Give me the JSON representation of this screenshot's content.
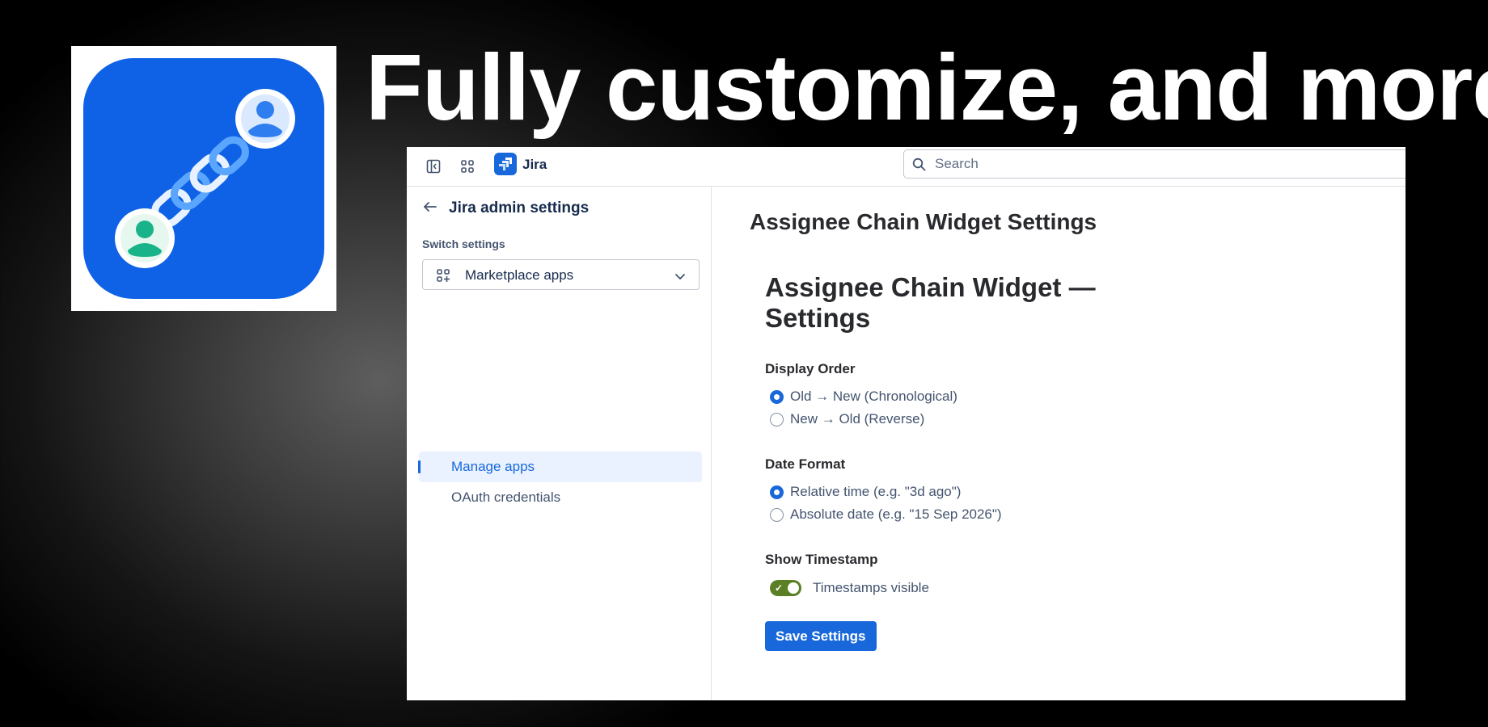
{
  "headline": "Fully customize, and more",
  "app_logo": {
    "icon": "assignee-chain-icon",
    "colors": {
      "tile": "#0f62e6",
      "avatar_top": "#2f7ef0",
      "avatar_bottom": "#19b389",
      "chain": "#5aa6ff"
    }
  },
  "topbar": {
    "app_name": "Jira",
    "search_placeholder": "Search"
  },
  "sidebar": {
    "back_title": "Jira admin settings",
    "switch_label": "Switch settings",
    "switch_value": "Marketplace apps",
    "items": [
      {
        "label": "Manage apps",
        "active": true
      },
      {
        "label": "OAuth credentials",
        "active": false
      }
    ]
  },
  "main": {
    "page_title": "Assignee Chain Widget Settings",
    "panel_title": "Assignee Chain Widget — Settings",
    "display_order": {
      "label": "Display Order",
      "options": [
        "Old → New (Chronological)",
        "New → Old (Reverse)"
      ],
      "selected": "Old → New (Chronological)"
    },
    "date_format": {
      "label": "Date Format",
      "options": [
        "Relative time (e.g. \"3d ago\")",
        "Absolute date (e.g. \"15 Sep 2026\")"
      ],
      "selected": "Relative time (e.g. \"3d ago\")"
    },
    "show_timestamp": {
      "label": "Show Timestamp",
      "toggle_label": "Timestamps visible",
      "on": true
    },
    "save_label": "Save Settings"
  },
  "colors": {
    "accent": "#1868db",
    "toggle_on": "#5b7f24",
    "selected_nav_bg": "#e9f2fe"
  }
}
